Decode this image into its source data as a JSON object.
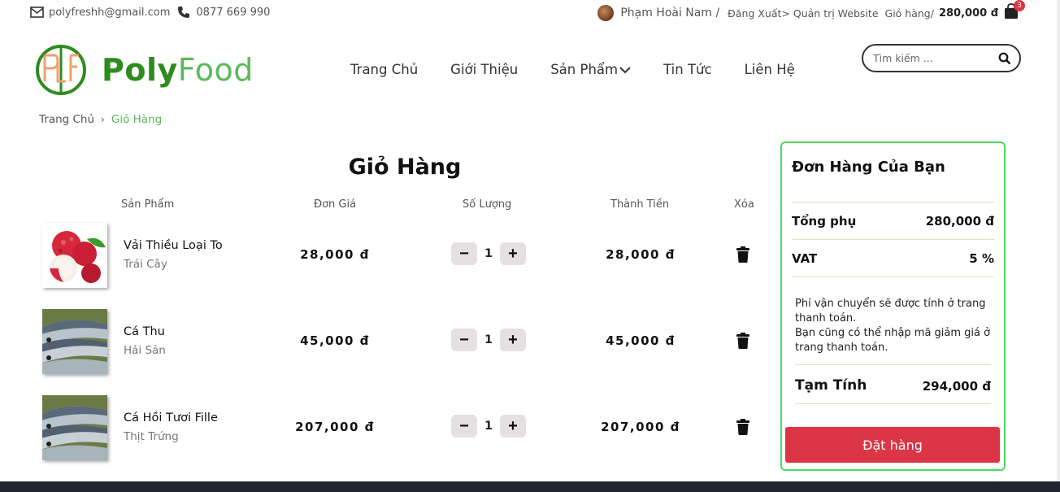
{
  "topbar": {
    "email": "polyfreshh@gmail.com",
    "phone": "0877 669 990",
    "user_name": "Phạm Hoài Nam /",
    "logout": "Đăng Xuất>",
    "admin": "Quản trị Website",
    "cart_label": "Giỏ hàng/",
    "cart_total": "280,000 đ",
    "cart_count": "3"
  },
  "logo": {
    "part1": "Poly",
    "part2": "Food"
  },
  "nav": {
    "home": "Trang Chủ",
    "about": "Giới Thiệu",
    "products": "Sản Phẩm",
    "news": "Tin Tức",
    "contact": "Liên Hệ"
  },
  "search": {
    "placeholder": "Tìm kiếm ..."
  },
  "breadcrumb": {
    "home": "Trang Chủ",
    "current": "Giỏ Hàng"
  },
  "cart": {
    "title": "Giỏ Hàng",
    "headers": {
      "product": "Sản Phẩm",
      "unit_price": "Đơn Giá",
      "quantity": "Số Lượng",
      "subtotal": "Thành Tiền",
      "remove": "Xóa"
    },
    "items": [
      {
        "name": "Vải Thiều Loại To",
        "category": "Trái Cây",
        "price": "28,000 đ",
        "qty": "1",
        "total": "28,000 đ",
        "image": "lychee"
      },
      {
        "name": "Cá Thu",
        "category": "Hải Sản",
        "price": "45,000 đ",
        "qty": "1",
        "total": "45,000 đ",
        "image": "fish"
      },
      {
        "name": "Cá Hồi Tươi Fille",
        "category": "Thịt Trứng",
        "price": "207,000 đ",
        "qty": "1",
        "total": "207,000 đ",
        "image": "fish"
      }
    ],
    "minus": "−",
    "plus": "+"
  },
  "summary": {
    "title": "Đơn Hàng Của Bạn",
    "subtotal_label": "Tổng phụ",
    "subtotal_value": "280,000 đ",
    "vat_label": "VAT",
    "vat_value": "5 %",
    "note_1": "Phí vận chuyển sẽ được tính ở trang thanh toán.",
    "note_2": "Bạn cũng có thể nhập mã giảm giá ở trang thanh toán.",
    "temp_label": "Tạm Tính",
    "temp_value": "294,000 đ",
    "order_button": "Đặt hàng"
  },
  "colors": {
    "accent_green": "#5cb85c",
    "brand_green": "#2e8b1e",
    "danger": "#dc3545",
    "border_green": "#4cd964"
  }
}
